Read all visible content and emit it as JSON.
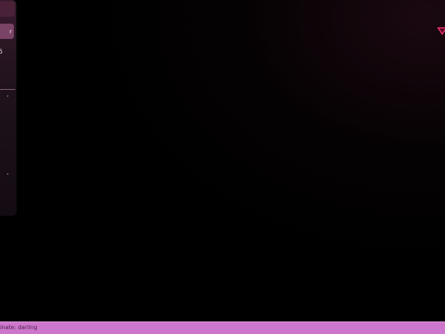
{
  "side_panel": {
    "top_button_label": "",
    "selected_button_label": "r",
    "value_text": "5"
  },
  "corner_marker": {
    "icon": "down-triangle-icon",
    "color": "#ff3377"
  },
  "status_bar": {
    "text": "rdinate: darling",
    "background": "#cc77cc",
    "text_color": "#4a1e44"
  }
}
